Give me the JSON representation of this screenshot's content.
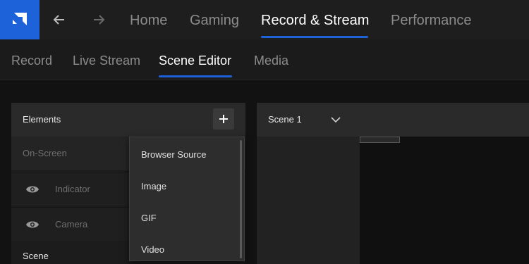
{
  "header": {
    "tabs": [
      {
        "label": "Home"
      },
      {
        "label": "Gaming"
      },
      {
        "label": "Record & Stream"
      },
      {
        "label": "Performance"
      }
    ],
    "active_tab": "Record & Stream"
  },
  "subnav": {
    "tabs": [
      {
        "label": "Record"
      },
      {
        "label": "Live Stream"
      },
      {
        "label": "Scene Editor"
      },
      {
        "label": "Media"
      }
    ],
    "active_tab": "Scene Editor"
  },
  "elements_panel": {
    "title": "Elements",
    "add_icon": "plus-icon",
    "rows": [
      {
        "label": "On-Screen"
      },
      {
        "label": "Indicator"
      },
      {
        "label": "Camera"
      },
      {
        "label": "Scene"
      }
    ]
  },
  "add_menu": {
    "items": [
      {
        "label": "Browser Source"
      },
      {
        "label": "Image"
      },
      {
        "label": "GIF"
      },
      {
        "label": "Video"
      }
    ]
  },
  "scene_panel": {
    "title": "Scene 1"
  },
  "colors": {
    "accent": "#1d62d8",
    "background": "#121212",
    "panel": "#1c1c1c"
  }
}
